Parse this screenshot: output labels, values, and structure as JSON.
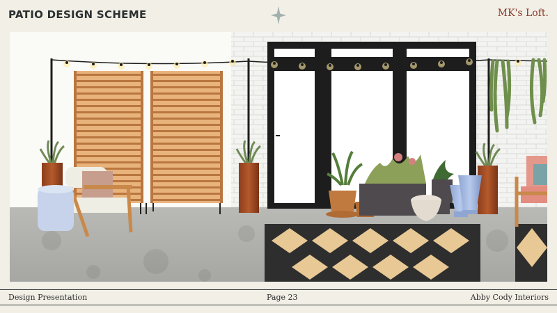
{
  "header": {
    "title": "Patio Design Scheme",
    "brand": "MK's Loft."
  },
  "footer": {
    "left": "Design Presentation",
    "center": "Page 23",
    "right": "Abby Cody Interiors"
  },
  "colors": {
    "background": "#f1efe6",
    "title": "#2b3030",
    "brand": "#8a3a2c",
    "star": "#9fb0ae"
  },
  "icons": {
    "star": "sparkle-star-icon"
  }
}
